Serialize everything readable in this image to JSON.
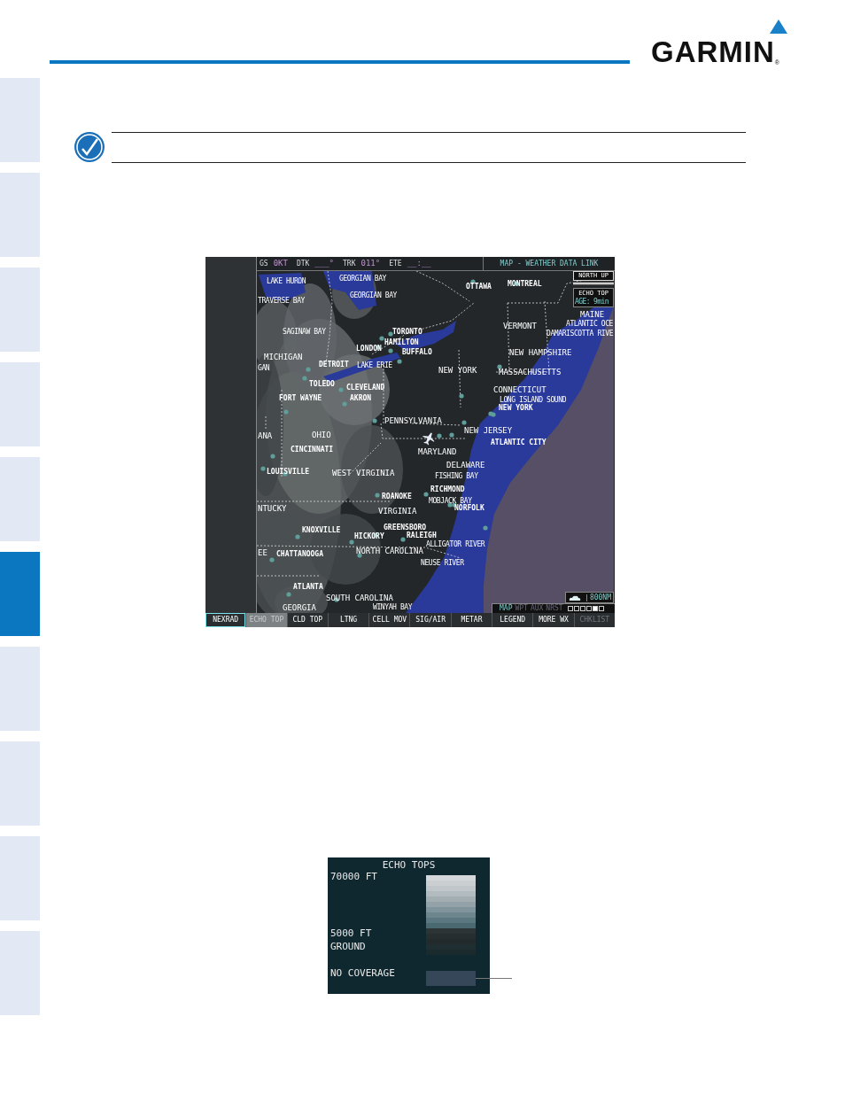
{
  "side_tabs": [
    {
      "selected": false
    },
    {
      "selected": false
    },
    {
      "selected": false
    },
    {
      "selected": false
    },
    {
      "selected": false
    },
    {
      "selected": true
    },
    {
      "selected": false
    },
    {
      "selected": false
    },
    {
      "selected": false
    },
    {
      "selected": false
    }
  ],
  "logo": {
    "text": "GARMIN",
    "registered_mark": "®"
  },
  "map": {
    "status_bar": [
      {
        "label": "GS",
        "value": "0KT"
      },
      {
        "label": "DTK",
        "value": "___°"
      },
      {
        "label": "TRK",
        "value": "011°"
      },
      {
        "label": "ETE",
        "value": "__:__"
      }
    ],
    "title": "MAP - WEATHER DATA LINK",
    "orientation": "NORTH UP",
    "product": {
      "name": "ECHO TOP",
      "age": "AGE: 9min"
    },
    "labels": [
      {
        "text": "LAKE HURON",
        "kind": "water"
      },
      {
        "text": "GEORGIAN BAY",
        "kind": "water"
      },
      {
        "text": "GEORGIAN BAY",
        "kind": "water"
      },
      {
        "text": "OTTAWA",
        "kind": "city"
      },
      {
        "text": "MONTREAL",
        "kind": "city"
      },
      {
        "text": "TRAVERSE BAY",
        "kind": "water"
      },
      {
        "text": "MAINE",
        "kind": "state"
      },
      {
        "text": "ATLANTIC OCE",
        "kind": "water"
      },
      {
        "text": "DAMARISCOTTA RIVE",
        "kind": "water"
      },
      {
        "text": "VERMONT",
        "kind": "state"
      },
      {
        "text": "SAGINAW BAY",
        "kind": "water"
      },
      {
        "text": "TORONTO",
        "kind": "city"
      },
      {
        "text": "HAMILTON",
        "kind": "city"
      },
      {
        "text": "LONDON",
        "kind": "city"
      },
      {
        "text": "BUFFALO",
        "kind": "city"
      },
      {
        "text": "NEW HAMPSHIRE",
        "kind": "state"
      },
      {
        "text": "MICHIGAN",
        "kind": "state"
      },
      {
        "text": "GAN",
        "kind": "water"
      },
      {
        "text": "DETROIT",
        "kind": "city"
      },
      {
        "text": "LAKE ERIE",
        "kind": "water"
      },
      {
        "text": "NEW YORK",
        "kind": "state"
      },
      {
        "text": "MASSACHUSETTS",
        "kind": "state"
      },
      {
        "text": "TOLEDO",
        "kind": "city"
      },
      {
        "text": "CLEVELAND",
        "kind": "city"
      },
      {
        "text": "CONNECTICUT",
        "kind": "state"
      },
      {
        "text": "FORT WAYNE",
        "kind": "city"
      },
      {
        "text": "AKRON",
        "kind": "city"
      },
      {
        "text": "LONG ISLAND SOUND",
        "kind": "water"
      },
      {
        "text": "NEW YORK",
        "kind": "city"
      },
      {
        "text": "PENNSYLVANIA",
        "kind": "state"
      },
      {
        "text": "NEW JERSEY",
        "kind": "state"
      },
      {
        "text": "ANA",
        "kind": "state"
      },
      {
        "text": "OHIO",
        "kind": "state"
      },
      {
        "text": "ATLANTIC CITY",
        "kind": "city"
      },
      {
        "text": "CINCINNATI",
        "kind": "city"
      },
      {
        "text": "MARYLAND",
        "kind": "state"
      },
      {
        "text": "DELAWARE",
        "kind": "state"
      },
      {
        "text": "LOUISVILLE",
        "kind": "city"
      },
      {
        "text": "WEST VIRGINIA",
        "kind": "state"
      },
      {
        "text": "FISHING BAY",
        "kind": "water"
      },
      {
        "text": "RICHMOND",
        "kind": "city"
      },
      {
        "text": "ROANOKE",
        "kind": "city"
      },
      {
        "text": "MOBJACK BAY",
        "kind": "water"
      },
      {
        "text": "NORFOLK",
        "kind": "city"
      },
      {
        "text": "NTUCKY",
        "kind": "state"
      },
      {
        "text": "VIRGINIA",
        "kind": "state"
      },
      {
        "text": "GREENSBORO",
        "kind": "city"
      },
      {
        "text": "KNOXVILLE",
        "kind": "city"
      },
      {
        "text": "HICKORY",
        "kind": "city"
      },
      {
        "text": "RALEIGH",
        "kind": "city"
      },
      {
        "text": "ALLIGATOR RIVER",
        "kind": "water"
      },
      {
        "text": "EE",
        "kind": "state"
      },
      {
        "text": "CHATTANOOGA",
        "kind": "city"
      },
      {
        "text": "NORTH CAROLINA",
        "kind": "state"
      },
      {
        "text": "NEUSE RIVER",
        "kind": "water"
      },
      {
        "text": "ATLANTA",
        "kind": "city"
      },
      {
        "text": "SOUTH CAROLINA",
        "kind": "state"
      },
      {
        "text": "WINYAH BAY",
        "kind": "water"
      },
      {
        "text": "GEORGIA",
        "kind": "state"
      }
    ],
    "range": "800NM",
    "page_groups": [
      {
        "label": "MAP",
        "selected": true
      },
      {
        "label": "WPT",
        "selected": false
      },
      {
        "label": "AUX",
        "selected": false
      },
      {
        "label": "NRST",
        "selected": false
      }
    ],
    "page_dots": [
      {
        "selected": false
      },
      {
        "selected": false
      },
      {
        "selected": false
      },
      {
        "selected": false
      },
      {
        "selected": true
      },
      {
        "selected": false
      }
    ],
    "softkeys": [
      {
        "label": "NEXRAD",
        "selected": true,
        "on": false,
        "disabled": false
      },
      {
        "label": "ECHO TOP",
        "selected": false,
        "on": true,
        "disabled": false
      },
      {
        "label": "CLD TOP",
        "selected": false,
        "on": false,
        "disabled": false
      },
      {
        "label": "LTNG",
        "selected": false,
        "on": false,
        "disabled": false
      },
      {
        "label": "CELL MOV",
        "selected": false,
        "on": false,
        "disabled": false
      },
      {
        "label": "SIG/AIR",
        "selected": false,
        "on": false,
        "disabled": false
      },
      {
        "label": "METAR",
        "selected": false,
        "on": false,
        "disabled": false
      },
      {
        "label": "LEGEND",
        "selected": false,
        "on": false,
        "disabled": false
      },
      {
        "label": "MORE WX",
        "selected": false,
        "on": false,
        "disabled": false
      },
      {
        "label": "CHKLIST",
        "selected": false,
        "on": false,
        "disabled": true
      }
    ]
  },
  "legend": {
    "title": "ECHO TOPS",
    "labels": [
      "70000 FT",
      "5000 FT",
      "GROUND",
      "NO COVERAGE"
    ]
  }
}
